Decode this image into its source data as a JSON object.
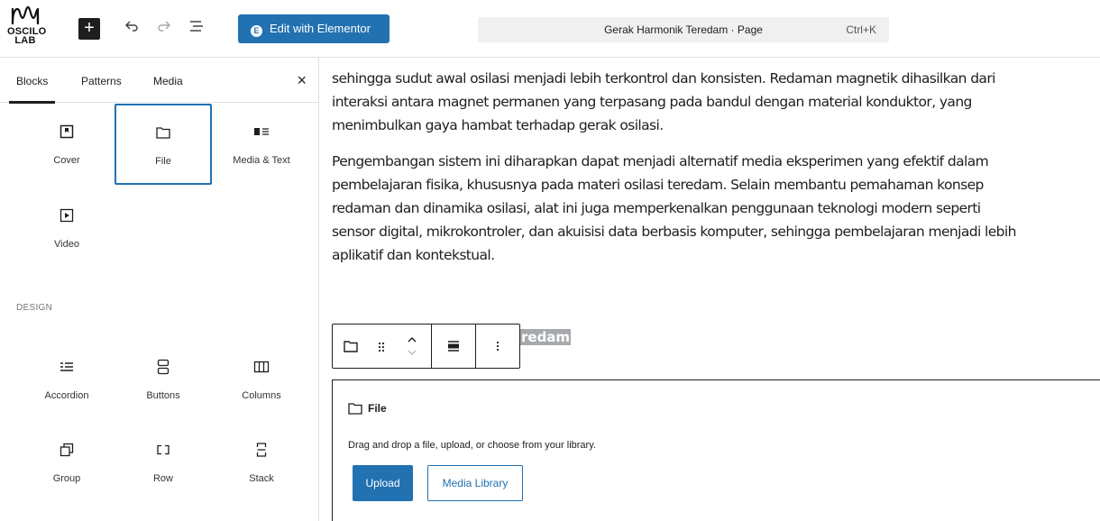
{
  "logo": {
    "name": "OSCILO",
    "sub": "LAB"
  },
  "toolbar": {
    "add_icon": "plus-icon",
    "undo_icon": "undo-icon",
    "redo_icon": "redo-icon",
    "outline_icon": "document-overview-icon",
    "elementor_label": "Edit with Elementor",
    "command_title": "Gerak Harmonik Teredam · Page",
    "command_shortcut": "Ctrl+K"
  },
  "sidebar": {
    "tabs": [
      "Blocks",
      "Patterns",
      "Media"
    ],
    "active_tab": "Blocks",
    "close_icon": "close-icon",
    "blocks_top": [
      {
        "label": "Cover",
        "icon": "cover-icon"
      },
      {
        "label": "File",
        "icon": "file-icon",
        "selected": true
      },
      {
        "label": "Media & Text",
        "icon": "media-text-icon"
      },
      {
        "label": "Video",
        "icon": "video-icon"
      }
    ],
    "section_design": "DESIGN",
    "blocks_design": [
      {
        "label": "Accordion",
        "icon": "accordion-icon"
      },
      {
        "label": "Buttons",
        "icon": "buttons-icon"
      },
      {
        "label": "Columns",
        "icon": "columns-icon"
      },
      {
        "label": "Group",
        "icon": "group-icon"
      },
      {
        "label": "Row",
        "icon": "row-icon"
      },
      {
        "label": "Stack",
        "icon": "stack-icon"
      }
    ]
  },
  "content": {
    "para1_lines": [
      "sehingga sudut awal osilasi menjadi lebih terkontrol dan konsisten. Redaman magnetik dihasilkan dari",
      "interaksi antara magnet permanen yang terpasang pada bandul dengan material konduktor, yang",
      "menimbulkan gaya hambat terhadap gerak osilasi."
    ],
    "para2_lines": [
      "Pengembangan sistem ini diharapkan dapat menjadi alternatif media eksperimen yang efektif dalam",
      "pembelajaran fisika, khususnya pada materi osilasi teredam. Selain membantu pemahaman konsep",
      "redaman dan dinamika osilasi, alat ini juga memperkenalkan penggunaan teknologi modern seperti",
      "sensor digital, mikrokontroler, dan akuisisi data berbasis komputer, sehingga pembelajaran menjadi lebih",
      "aplikatif dan kontekstual."
    ],
    "heading_fragment": "redam",
    "block_toolbar": {
      "type_icon": "file-icon",
      "drag_icon": "drag-handle-icon",
      "move_icon": "move-up-down-icon",
      "align_icon": "align-icon",
      "more_icon": "more-vertical-icon"
    },
    "file_block": {
      "title": "File",
      "description": "Drag and drop a file, upload, or choose from your library.",
      "upload_label": "Upload",
      "media_library_label": "Media Library"
    }
  }
}
